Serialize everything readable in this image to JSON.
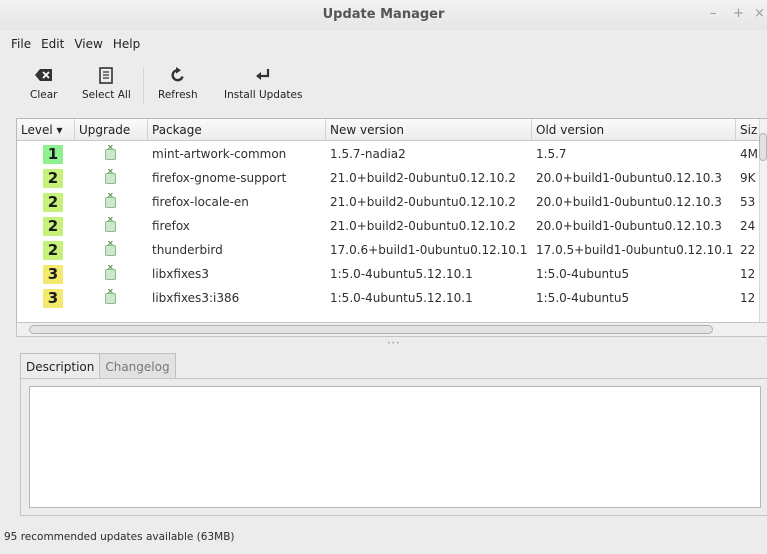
{
  "window": {
    "title": "Update Manager",
    "controls": [
      "–",
      "+",
      "×"
    ]
  },
  "menu": [
    "File",
    "Edit",
    "View",
    "Help"
  ],
  "toolbar": {
    "clear": {
      "label": "Clear",
      "icon": "backspace-icon"
    },
    "select_all": {
      "label": "Select All",
      "icon": "list-icon"
    },
    "refresh": {
      "label": "Refresh",
      "icon": "refresh-icon"
    },
    "install": {
      "label": "Install Updates",
      "icon": "enter-arrow-icon"
    }
  },
  "table": {
    "columns": [
      "Level ▾",
      "Upgrade",
      "Package",
      "New version",
      "Old version",
      "Siz"
    ],
    "rows": [
      {
        "level": "1",
        "level_color": "#8ef08e",
        "package": "mint-artwork-common",
        "new": "1.5.7-nadia2",
        "old": "1.5.7",
        "size": "4M"
      },
      {
        "level": "2",
        "level_color": "#c6f27a",
        "package": "firefox-gnome-support",
        "new": "21.0+build2-0ubuntu0.12.10.2",
        "old": "20.0+build1-0ubuntu0.12.10.3",
        "size": "9K"
      },
      {
        "level": "2",
        "level_color": "#c6f27a",
        "package": "firefox-locale-en",
        "new": "21.0+build2-0ubuntu0.12.10.2",
        "old": "20.0+build1-0ubuntu0.12.10.3",
        "size": "53"
      },
      {
        "level": "2",
        "level_color": "#c6f27a",
        "package": "firefox",
        "new": "21.0+build2-0ubuntu0.12.10.2",
        "old": "20.0+build1-0ubuntu0.12.10.3",
        "size": "24"
      },
      {
        "level": "2",
        "level_color": "#c6f27a",
        "package": "thunderbird",
        "new": "17.0.6+build1-0ubuntu0.12.10.1",
        "old": "17.0.5+build1-0ubuntu0.12.10.1",
        "size": "22"
      },
      {
        "level": "3",
        "level_color": "#f4e96e",
        "package": "libxfixes3",
        "new": "1:5.0-4ubuntu5.12.10.1",
        "old": "1:5.0-4ubuntu5",
        "size": "12"
      },
      {
        "level": "3",
        "level_color": "#f4e96e",
        "package": "libxfixes3:i386",
        "new": "1:5.0-4ubuntu5.12.10.1",
        "old": "1:5.0-4ubuntu5",
        "size": "12"
      }
    ]
  },
  "tabs": [
    "Description",
    "Changelog"
  ],
  "status": "95 recommended updates available (63MB)"
}
